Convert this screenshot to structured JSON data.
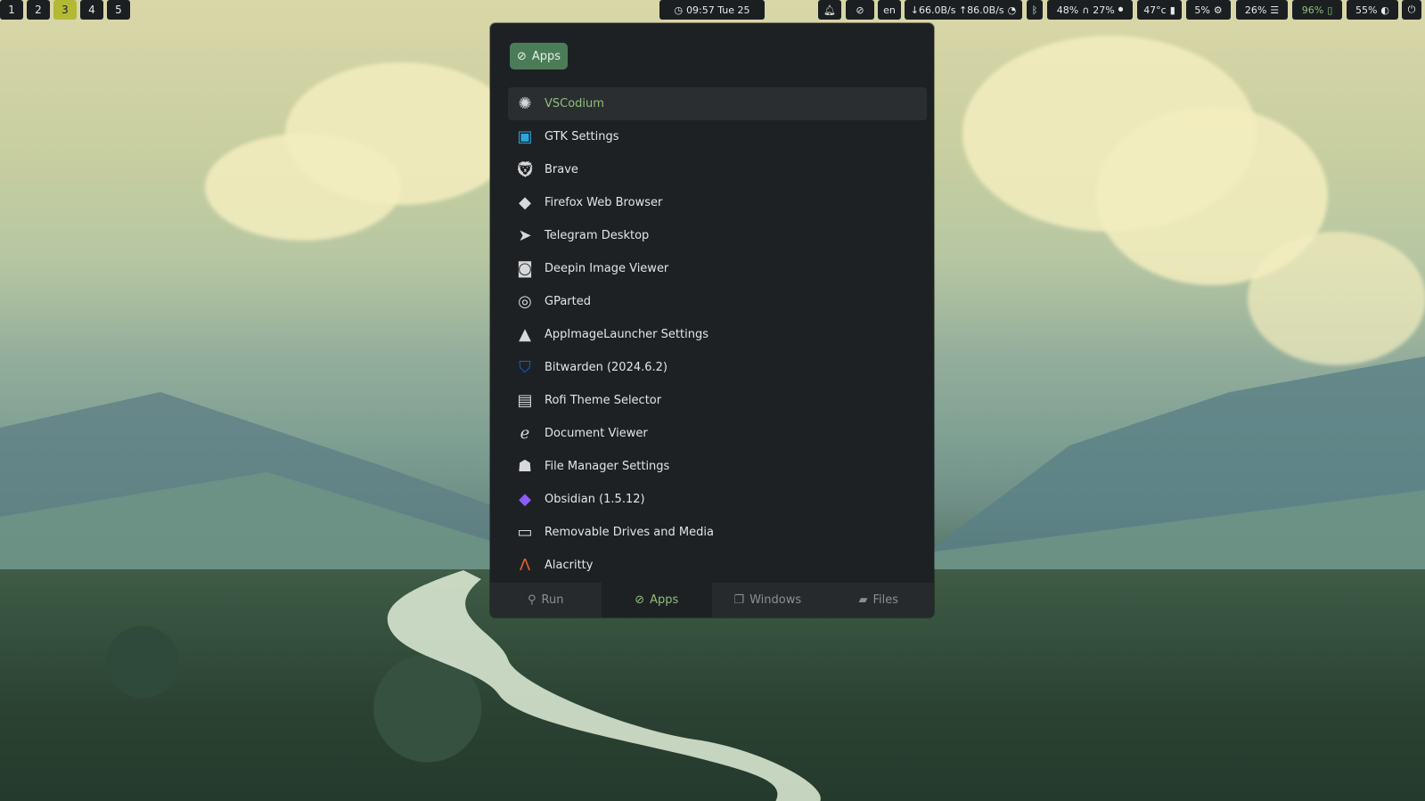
{
  "workspaces": [
    {
      "label": "1",
      "active": false
    },
    {
      "label": "2",
      "active": false
    },
    {
      "label": "3",
      "active": true
    },
    {
      "label": "4",
      "active": false
    },
    {
      "label": "5",
      "active": false
    }
  ],
  "clock": {
    "text": "09:57 Tue 25"
  },
  "status": {
    "notification_icon": "bell-icon",
    "privacy_icon": "eye-slash-icon",
    "keyboard_layout": "en",
    "network": "↓66.0B/s ↑86.0B/s",
    "audio_volume": "48%",
    "mic_volume": "27%",
    "temperature": "47°c",
    "cpu": "5%",
    "memory": "26%",
    "battery": "96%",
    "brightness": "55%"
  },
  "launcher": {
    "mode_label": "Apps",
    "items": [
      {
        "label": "VSCodium",
        "icon": "vscodium-icon",
        "color": "#d8d8d8",
        "selected": true
      },
      {
        "label": "GTK Settings",
        "icon": "gtk-settings-icon",
        "color": "#2aa6d8",
        "selected": false
      },
      {
        "label": "Brave",
        "icon": "brave-icon",
        "color": "#d8d8d8",
        "selected": false
      },
      {
        "label": "Firefox Web Browser",
        "icon": "firefox-icon",
        "color": "#d8d8d8",
        "selected": false
      },
      {
        "label": "Telegram Desktop",
        "icon": "telegram-icon",
        "color": "#d8d8d8",
        "selected": false
      },
      {
        "label": "Deepin Image Viewer",
        "icon": "image-viewer-icon",
        "color": "#d8d8d8",
        "selected": false
      },
      {
        "label": "GParted",
        "icon": "gparted-icon",
        "color": "#d8d8d8",
        "selected": false
      },
      {
        "label": "AppImageLauncher Settings",
        "icon": "appimagelauncher-icon",
        "color": "#d8d8d8",
        "selected": false
      },
      {
        "label": "Bitwarden (2024.6.2)",
        "icon": "bitwarden-icon",
        "color": "#175ddc",
        "selected": false
      },
      {
        "label": "Rofi Theme Selector",
        "icon": "rofi-icon",
        "color": "#d8d8d8",
        "selected": false
      },
      {
        "label": "Document Viewer",
        "icon": "document-viewer-icon",
        "color": "#d8d8d8",
        "selected": false
      },
      {
        "label": "File Manager Settings",
        "icon": "file-manager-icon",
        "color": "#d8d8d8",
        "selected": false
      },
      {
        "label": "Obsidian (1.5.12)",
        "icon": "obsidian-icon",
        "color": "#8b5cf6",
        "selected": false
      },
      {
        "label": "Removable Drives and Media",
        "icon": "drive-icon",
        "color": "#d8d8d8",
        "selected": false
      },
      {
        "label": "Alacritty",
        "icon": "alacritty-icon",
        "color": "#e0602e",
        "selected": false
      }
    ],
    "tabs": [
      {
        "label": "Run",
        "icon": "run-icon",
        "active": false
      },
      {
        "label": "Apps",
        "icon": "apps-icon",
        "active": true
      },
      {
        "label": "Windows",
        "icon": "windows-icon",
        "active": false
      },
      {
        "label": "Files",
        "icon": "folder-icon",
        "active": false
      }
    ]
  },
  "colors": {
    "accent": "#8fbf7b",
    "bar_bg": "#1c1f22",
    "active_workspace": "#b3b934",
    "launcher_bg": "#1e2124"
  }
}
